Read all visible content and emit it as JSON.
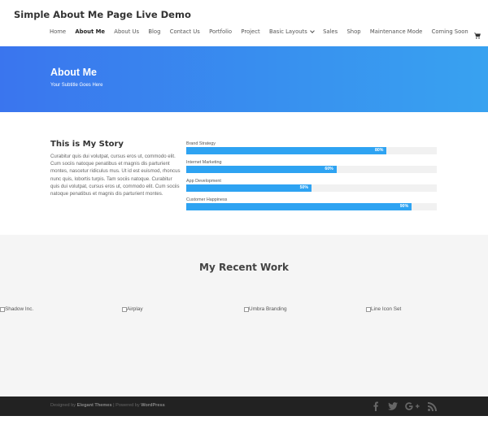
{
  "site": {
    "title": "Simple About Me Page Live Demo"
  },
  "nav": {
    "items": [
      {
        "label": "Home"
      },
      {
        "label": "About Me",
        "active": true
      },
      {
        "label": "About Us"
      },
      {
        "label": "Blog"
      },
      {
        "label": "Contact Us"
      },
      {
        "label": "Portfolio"
      },
      {
        "label": "Project"
      },
      {
        "label": "Basic Layouts",
        "dropdown": true
      },
      {
        "label": "Sales"
      },
      {
        "label": "Shop"
      },
      {
        "label": "Maintenance Mode"
      },
      {
        "label": "Coming Soon"
      }
    ],
    "cart_icon": "cart-icon"
  },
  "hero": {
    "title": "About Me",
    "subtitle": "Your Subtitle Goes Here",
    "gradient": [
      "#3a75ee",
      "#38a2f0"
    ]
  },
  "story": {
    "title": "This is My Story",
    "text": "Curabitur quis dui volutpat, cursus eros ut, commodo elit. Cum sociis natoque penatibus et magnis dis parturient montes, nascetur ridiculus mus. Ut id est euismod, rhoncus nunc quis, lobortis turpis. Tam sociis natoque. Curabitur quis dui volutpat, cursus eros ut, commodo elit. Cum sociis natoque penatibus et magnis dis parturient montes."
  },
  "skills": [
    {
      "label": "Brand Strategy",
      "value_text": "80%",
      "value": 80
    },
    {
      "label": "Internet Marketing",
      "value_text": "60%",
      "value": 60
    },
    {
      "label": "App Development",
      "value_text": "50%",
      "value": 50
    },
    {
      "label": "Customer Happiness",
      "value_text": "90%",
      "value": 90
    }
  ],
  "work": {
    "title": "My Recent Work",
    "items": [
      {
        "label": "Shadow Inc."
      },
      {
        "label": "Airplay"
      },
      {
        "label": "Umbra Branding"
      },
      {
        "label": "Line Icon Set"
      }
    ]
  },
  "footer": {
    "designed_by": "Designed by",
    "elegant": "Elegant Themes",
    "separator": "| Powered by",
    "wordpress": "WordPress",
    "social_icons": [
      "facebook-icon",
      "twitter-icon",
      "google-plus-icon",
      "rss-icon"
    ]
  },
  "colors": {
    "accent": "#2ea3f2",
    "footer_bg": "#222222",
    "work_bg": "#f5f5f5"
  }
}
